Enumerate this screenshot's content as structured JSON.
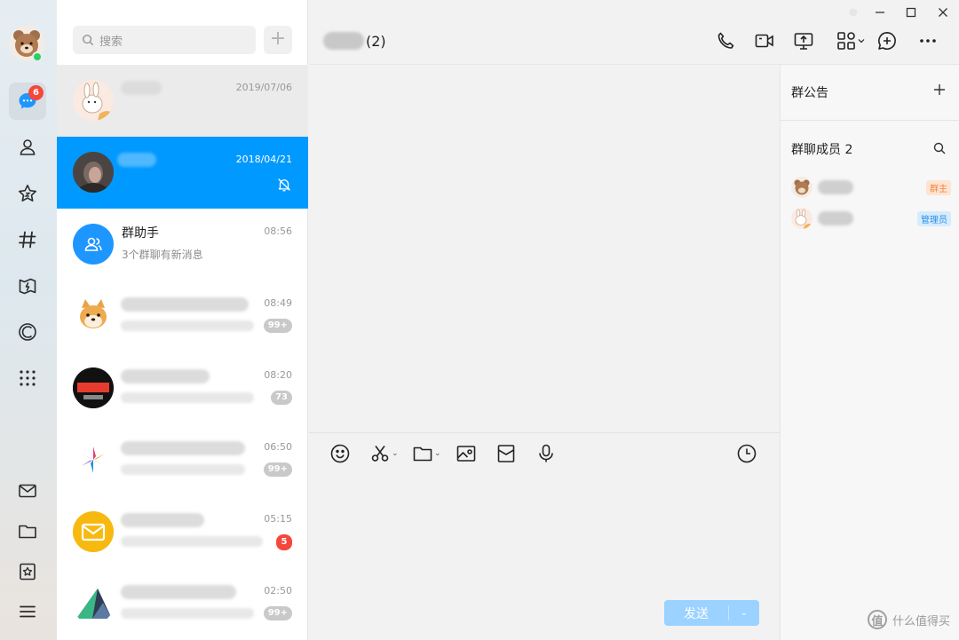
{
  "nav": {
    "unread_badge": "6",
    "items": [
      {
        "name": "messages-icon"
      },
      {
        "name": "contacts-icon"
      },
      {
        "name": "star-icon"
      },
      {
        "name": "hash-channel-icon"
      },
      {
        "name": "game-center-icon"
      },
      {
        "name": "zone-icon"
      },
      {
        "name": "more-apps-icon"
      },
      {
        "name": "mail-icon"
      },
      {
        "name": "folder-icon"
      },
      {
        "name": "favorites-icon"
      },
      {
        "name": "menu-icon"
      }
    ]
  },
  "search": {
    "placeholder": "搜索",
    "add_label": "+"
  },
  "conversations": [
    {
      "time": "2019/07/06",
      "name": "",
      "sub": "",
      "badge": ""
    },
    {
      "time": "2018/04/21",
      "name": "",
      "sub": "",
      "badge": "",
      "muted": true
    },
    {
      "time": "08:56",
      "name": "群助手",
      "sub": "3个群聊有新消息",
      "badge": ""
    },
    {
      "time": "08:49",
      "name": "",
      "sub": "",
      "badge": "99+"
    },
    {
      "time": "08:20",
      "name": "",
      "sub": "",
      "badge": "73"
    },
    {
      "time": "06:50",
      "name": "",
      "sub": "",
      "badge": "99+"
    },
    {
      "time": "05:15",
      "name": "",
      "sub": "",
      "badge": "5"
    },
    {
      "time": "02:50",
      "name": "",
      "sub": "",
      "badge": "99+"
    }
  ],
  "chat": {
    "title_count": "(2)",
    "send_label": "发送"
  },
  "side_panel": {
    "announcement_title": "群公告",
    "members_title": "群聊成员 2",
    "members": [
      {
        "role": "群主"
      },
      {
        "role": "管理员"
      }
    ]
  },
  "watermark": {
    "icon_text": "值",
    "text": "什么值得买"
  },
  "colors": {
    "accent": "#0099ff",
    "badge_red": "#f5473b",
    "online": "#2bd159"
  }
}
